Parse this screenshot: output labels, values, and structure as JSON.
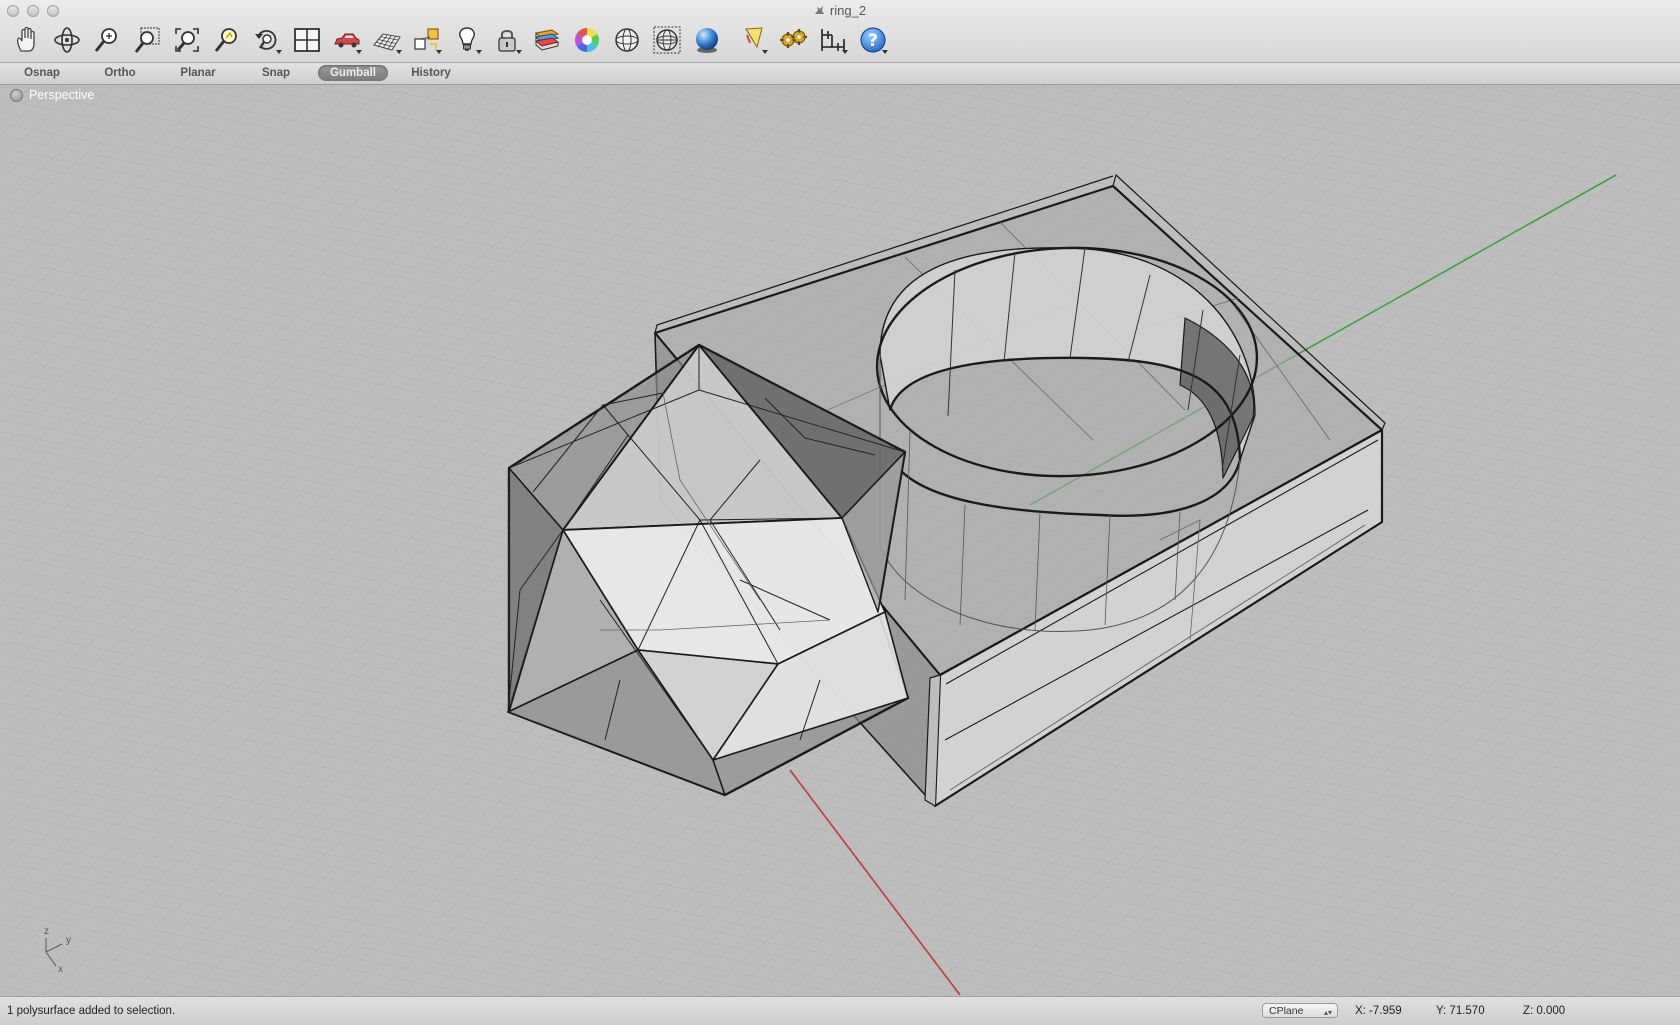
{
  "window": {
    "title": "ring_2"
  },
  "toolbar": {
    "tools": [
      {
        "name": "pan-hand-icon"
      },
      {
        "name": "rotate-view-icon"
      },
      {
        "name": "zoom-in-out-icon"
      },
      {
        "name": "zoom-window-icon"
      },
      {
        "name": "zoom-extents-icon"
      },
      {
        "name": "zoom-selected-icon"
      },
      {
        "name": "undo-view-icon"
      },
      {
        "name": "viewport-layout-icon"
      },
      {
        "name": "car-render-icon"
      },
      {
        "name": "grid-icon"
      },
      {
        "name": "gumball-transform-icon"
      },
      {
        "name": "light-bulb-icon"
      },
      {
        "name": "lock-icon"
      },
      {
        "name": "layer-book-icon"
      },
      {
        "name": "color-wheel-icon"
      },
      {
        "name": "wireframe-sphere-icon"
      },
      {
        "name": "mesh-sphere-icon"
      },
      {
        "name": "render-sphere-icon"
      },
      {
        "name": "select-filter-icon"
      },
      {
        "name": "options-gear-icon"
      },
      {
        "name": "dimension-icon"
      },
      {
        "name": "help-icon"
      }
    ]
  },
  "modes": [
    {
      "label": "Osnap",
      "active": false
    },
    {
      "label": "Ortho",
      "active": false
    },
    {
      "label": "Planar",
      "active": false
    },
    {
      "label": "Snap",
      "active": false
    },
    {
      "label": "Gumball",
      "active": true
    },
    {
      "label": "History",
      "active": false
    }
  ],
  "viewport": {
    "label": "Perspective"
  },
  "axes": {
    "z": "z",
    "y": "y",
    "x": "x"
  },
  "status": {
    "message": "1 polysurface added to selection.",
    "cplane": "CPlane",
    "x": "X: -7.959",
    "y": "Y: 71.570",
    "z": "Z: 0.000"
  },
  "colors": {
    "x_axis": "#c23a3a",
    "y_axis": "#3aa43a",
    "grid": "#adadad",
    "viewport_bg": "#bdbdbd"
  }
}
